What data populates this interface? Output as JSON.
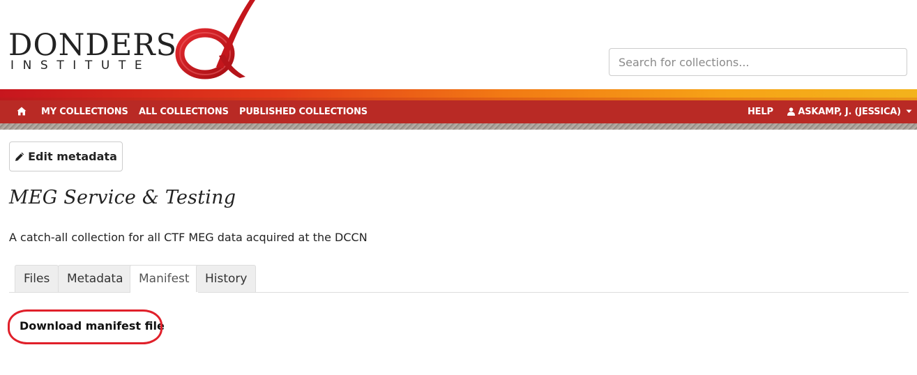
{
  "brand": {
    "title": "DONDERS",
    "subtitle": "INSTITUTE",
    "logo_icon": "alpha-logo-mark",
    "accent_color": "#c8171e"
  },
  "search": {
    "placeholder": "Search for collections...",
    "value": ""
  },
  "nav": {
    "home_icon": "home-icon",
    "items": [
      {
        "label": "MY COLLECTIONS"
      },
      {
        "label": "ALL COLLECTIONS"
      },
      {
        "label": "PUBLISHED COLLECTIONS"
      }
    ],
    "help_label": "HELP",
    "user_label": "ASKAMP, J. (JESSICA)",
    "user_icon": "user-icon",
    "caret_icon": "caret-down-icon",
    "background_color": "#b92a25"
  },
  "toolbar": {
    "edit_label": "Edit metadata",
    "edit_icon": "pencil-icon"
  },
  "collection": {
    "title": "MEG Service & Testing",
    "description": "A catch-all collection for all CTF MEG data acquired at the DCCN"
  },
  "tabs": [
    {
      "label": "Files",
      "active": false
    },
    {
      "label": "Metadata",
      "active": false
    },
    {
      "label": "Manifest",
      "active": true
    },
    {
      "label": "History",
      "active": false
    }
  ],
  "manifest": {
    "download_label": "Download manifest file",
    "highlight_color": "#e0202a"
  }
}
